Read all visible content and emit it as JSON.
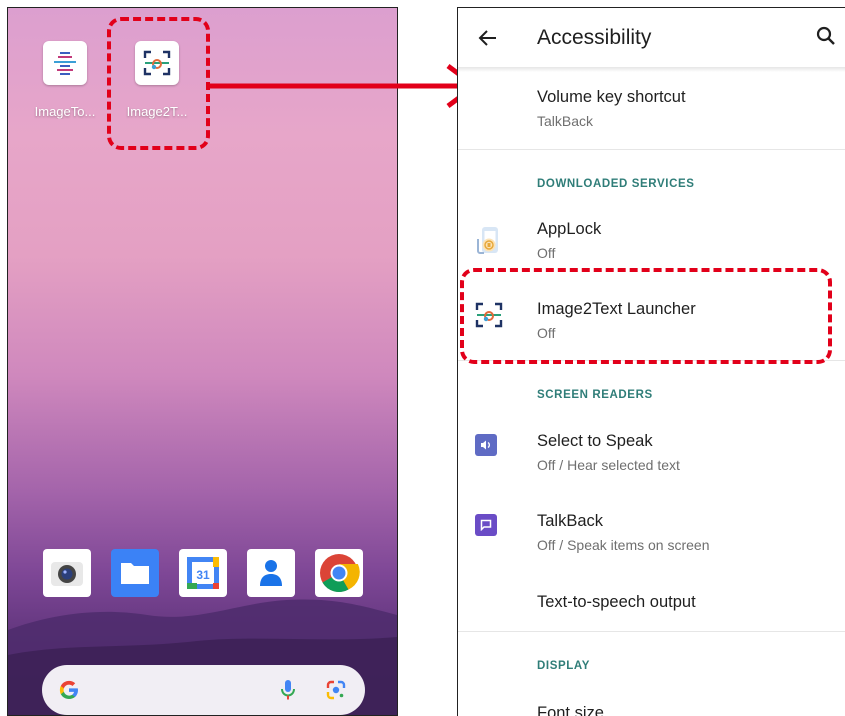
{
  "home": {
    "apps": [
      {
        "label": "ImageTo...",
        "icon": "text-scan-icon"
      },
      {
        "label": "Image2T...",
        "icon": "image2text-icon"
      }
    ],
    "dock": [
      "camera-icon",
      "files-icon",
      "calendar-icon",
      "contacts-icon",
      "chrome-icon"
    ],
    "calendar_day": "31",
    "search_logo": "G"
  },
  "settings": {
    "title": "Accessibility",
    "volume_key": {
      "title": "Volume key shortcut",
      "sub": "TalkBack"
    },
    "sections": {
      "downloaded": "DOWNLOADED SERVICES",
      "screen_readers": "SCREEN READERS",
      "display": "DISPLAY"
    },
    "applock": {
      "title": "AppLock",
      "sub": "Off"
    },
    "image2text": {
      "title": "Image2Text Launcher",
      "sub": "Off"
    },
    "select_to_speak": {
      "title": "Select to Speak",
      "sub": "Off / Hear selected text"
    },
    "talkback": {
      "title": "TalkBack",
      "sub": "Off / Speak items on screen"
    },
    "tts": {
      "title": "Text-to-speech output"
    },
    "font_size": {
      "title": "Font size"
    }
  },
  "colors": {
    "annotation_red": "#e2001a",
    "section_teal": "#2f7d78",
    "select_to_speak_bg": "#5f6bc4",
    "talkback_bg": "#6a4cc6"
  }
}
